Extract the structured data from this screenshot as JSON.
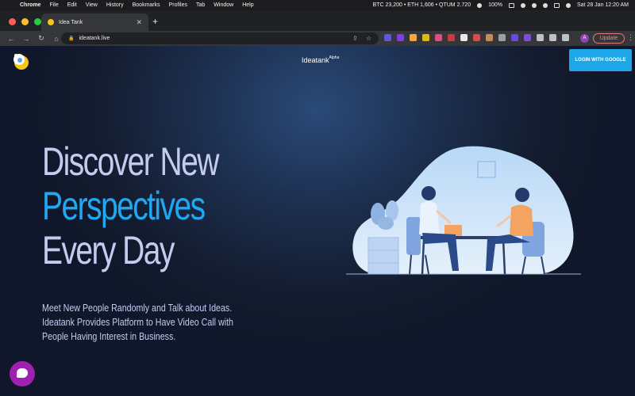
{
  "menubar": {
    "app": "Chrome",
    "items": [
      "File",
      "Edit",
      "View",
      "History",
      "Bookmarks",
      "Profiles",
      "Tab",
      "Window",
      "Help"
    ],
    "ticker": "BTC 23,200 • ETH 1,606 • QTUM 2.720",
    "battery": "100%",
    "datetime": "Sat 28 Jan  12:20 AM"
  },
  "browser": {
    "tab_title": "Idea Tank",
    "url": "ideatank.live",
    "update_label": "Update",
    "avatar_letter": "A",
    "extension_badges": [
      "7",
      "2"
    ]
  },
  "site": {
    "brand_name": "Ideatank",
    "brand_tag": "Alpha",
    "login_label": "LOGIN WITH GOOGLE",
    "headline_line1": "Discover New",
    "headline_line2": "Perspectives",
    "headline_line3": "Every Day",
    "subtitle": "Meet New People Randomly and Talk about Ideas. Ideatank Provides Platform to Have Video Call with People Having Interest in Business."
  },
  "colors": {
    "accent": "#21a8f3",
    "headline": "#c5cbef",
    "login_button": "#1ea7e8",
    "chat_widget": "#a020b0",
    "background": "#131b2e"
  }
}
